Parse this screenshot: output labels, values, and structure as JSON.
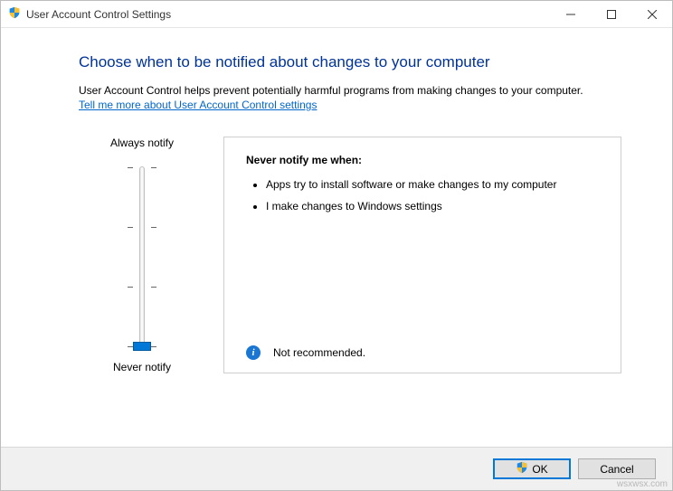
{
  "window": {
    "title": "User Account Control Settings"
  },
  "heading": "Choose when to be notified about changes to your computer",
  "description": "User Account Control helps prevent potentially harmful programs from making changes to your computer.",
  "link_text": "Tell me more about User Account Control settings",
  "slider": {
    "top_label": "Always notify",
    "bottom_label": "Never notify",
    "levels": 4,
    "current_level": 0
  },
  "info": {
    "title": "Never notify me when:",
    "items": [
      "Apps try to install software or make changes to my computer",
      "I make changes to Windows settings"
    ],
    "footer": "Not recommended."
  },
  "buttons": {
    "ok": "OK",
    "cancel": "Cancel"
  },
  "watermark": "wsxwsx.com"
}
